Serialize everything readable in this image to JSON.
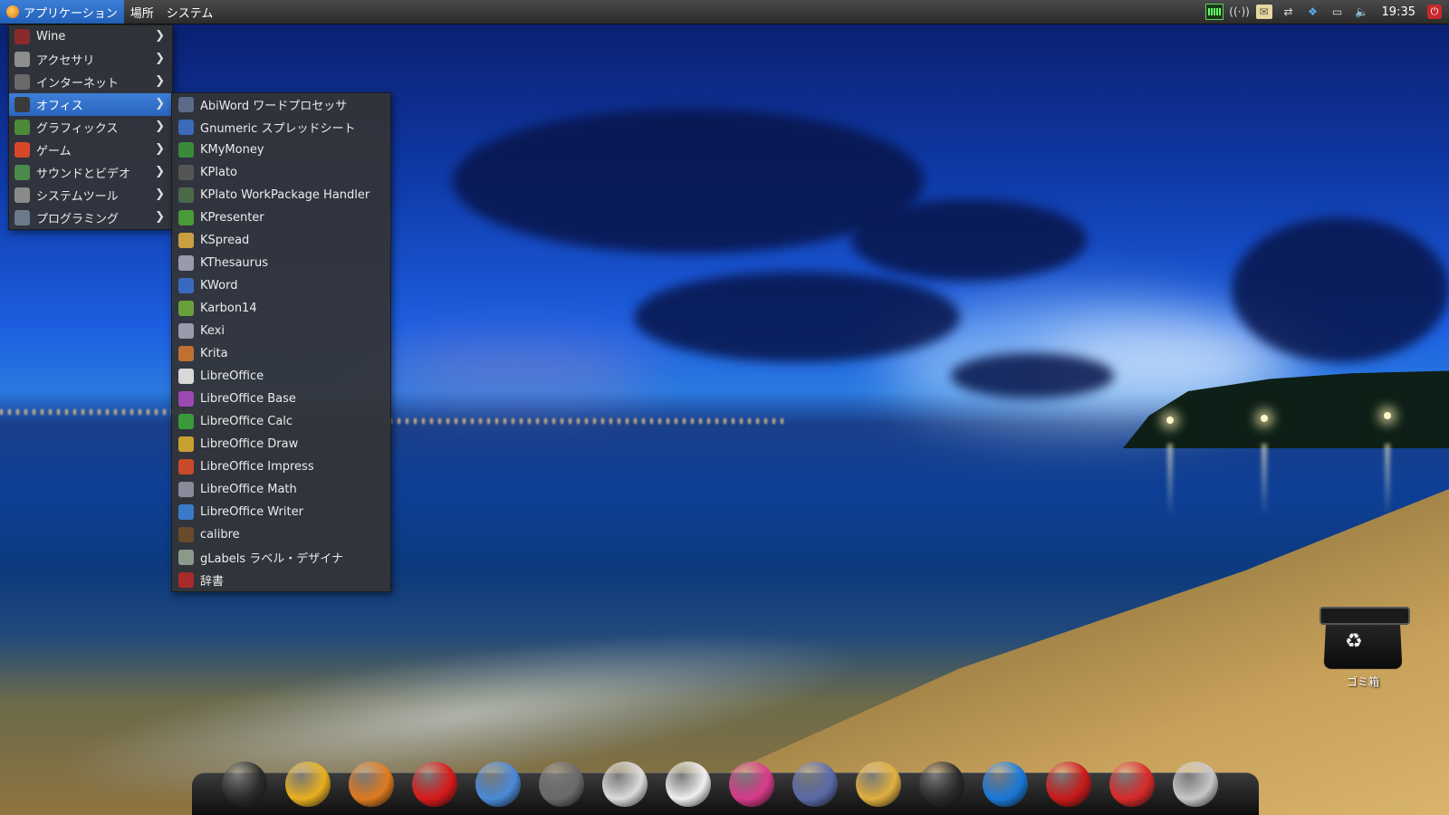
{
  "top_panel": {
    "menus": [
      {
        "label": "アプリケーション",
        "active": true
      },
      {
        "label": "場所",
        "active": false
      },
      {
        "label": "システム",
        "active": false
      }
    ],
    "tray": {
      "icons": [
        "system-monitor-icon",
        "wireless-icon",
        "email-icon",
        "network-icon",
        "dropbox-icon",
        "display-icon",
        "volume-icon"
      ],
      "clock": "19:35",
      "power_icon": "power-icon"
    }
  },
  "main_menu": {
    "items": [
      {
        "label": "Wine",
        "icon": "wine-icon",
        "color": "#8a2a2a",
        "highlighted": false
      },
      {
        "label": "アクセサリ",
        "icon": "accessories-icon",
        "color": "#8e8e8e",
        "highlighted": false
      },
      {
        "label": "インターネット",
        "icon": "internet-icon",
        "color": "#6a6a6a",
        "highlighted": false
      },
      {
        "label": "オフィス",
        "icon": "office-icon",
        "color": "#3b3b3b",
        "highlighted": true
      },
      {
        "label": "グラフィックス",
        "icon": "graphics-icon",
        "color": "#4c8a3a",
        "highlighted": false
      },
      {
        "label": "ゲーム",
        "icon": "games-icon",
        "color": "#d8472a",
        "highlighted": false
      },
      {
        "label": "サウンドとビデオ",
        "icon": "sound-video-icon",
        "color": "#4a8a4a",
        "highlighted": false
      },
      {
        "label": "システムツール",
        "icon": "system-tools-icon",
        "color": "#8a8a8a",
        "highlighted": false
      },
      {
        "label": "プログラミング",
        "icon": "programming-icon",
        "color": "#6a7a8a",
        "highlighted": false
      }
    ]
  },
  "office_submenu": {
    "items": [
      {
        "label": "AbiWord ワードプロセッサ",
        "icon": "abiword-icon",
        "color": "#5a6a88"
      },
      {
        "label": "Gnumeric スプレッドシート",
        "icon": "gnumeric-icon",
        "color": "#3a6ab8"
      },
      {
        "label": "KMyMoney",
        "icon": "kmymoney-icon",
        "color": "#3a8a3a"
      },
      {
        "label": "KPlato",
        "icon": "kplato-icon",
        "color": "#555555"
      },
      {
        "label": "KPlato WorkPackage Handler",
        "icon": "kplato-workpackage-icon",
        "color": "#4a6a4a"
      },
      {
        "label": "KPresenter",
        "icon": "kpresenter-icon",
        "color": "#4a9a3a"
      },
      {
        "label": "KSpread",
        "icon": "kspread-icon",
        "color": "#c8a040"
      },
      {
        "label": "KThesaurus",
        "icon": "kthesaurus-icon",
        "color": "#9a9aaa"
      },
      {
        "label": "KWord",
        "icon": "kword-icon",
        "color": "#3a6ac0"
      },
      {
        "label": "Karbon14",
        "icon": "karbon14-icon",
        "color": "#6aa03a"
      },
      {
        "label": "Kexi",
        "icon": "kexi-icon",
        "color": "#9a9aaa"
      },
      {
        "label": "Krita",
        "icon": "krita-icon",
        "color": "#c07030"
      },
      {
        "label": "LibreOffice",
        "icon": "libreoffice-icon",
        "color": "#d8d8d8"
      },
      {
        "label": "LibreOffice Base",
        "icon": "libreoffice-base-icon",
        "color": "#9a4ab0"
      },
      {
        "label": "LibreOffice Calc",
        "icon": "libreoffice-calc-icon",
        "color": "#3a9a3a"
      },
      {
        "label": "LibreOffice Draw",
        "icon": "libreoffice-draw-icon",
        "color": "#c8a030"
      },
      {
        "label": "LibreOffice Impress",
        "icon": "libreoffice-impress-icon",
        "color": "#c84a2a"
      },
      {
        "label": "LibreOffice Math",
        "icon": "libreoffice-math-icon",
        "color": "#8a8a9a"
      },
      {
        "label": "LibreOffice Writer",
        "icon": "libreoffice-writer-icon",
        "color": "#3a7ac8"
      },
      {
        "label": "calibre",
        "icon": "calibre-icon",
        "color": "#6a4a2a"
      },
      {
        "label": "gLabels ラベル・デザイナ",
        "icon": "glabels-icon",
        "color": "#8a9a8a"
      },
      {
        "label": "辞書",
        "icon": "dictionary-icon",
        "color": "#a82a2a"
      }
    ]
  },
  "desktop": {
    "trash_label": "ゴミ箱"
  },
  "dock": {
    "items": [
      {
        "name": "file-manager-icon",
        "color": "#2a2a2a"
      },
      {
        "name": "chrome-icon",
        "color": "#e8b020"
      },
      {
        "name": "firefox-icon",
        "color": "#e07a20"
      },
      {
        "name": "opera-icon",
        "color": "#d81a1a"
      },
      {
        "name": "chromium-icon",
        "color": "#4a8ad8"
      },
      {
        "name": "media-player-icon",
        "color": "#6a6a6a"
      },
      {
        "name": "text-editor-icon",
        "color": "#dcdcdc"
      },
      {
        "name": "document-icon",
        "color": "#f0f0f0"
      },
      {
        "name": "picasa-icon",
        "color": "#d83a8a"
      },
      {
        "name": "system-settings-icon",
        "color": "#5a6aa8"
      },
      {
        "name": "image-viewer-icon",
        "color": "#e0b040"
      },
      {
        "name": "audio-player-icon",
        "color": "#2a2a2a"
      },
      {
        "name": "teamviewer-icon",
        "color": "#1a78d8"
      },
      {
        "name": "pen-icon",
        "color": "#c81a1a"
      },
      {
        "name": "shutdown-icon",
        "color": "#d82a2a"
      },
      {
        "name": "volume-dock-icon",
        "color": "#c8c8c8"
      }
    ]
  }
}
